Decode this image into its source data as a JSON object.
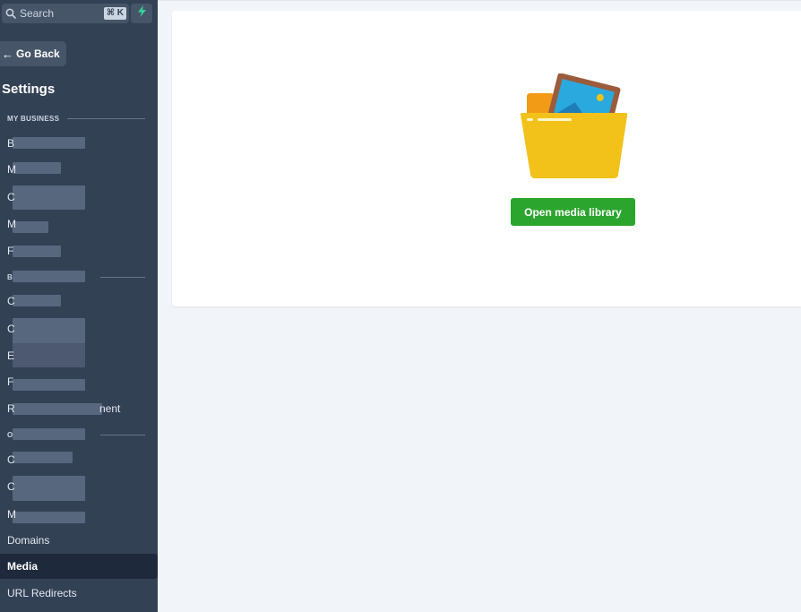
{
  "search": {
    "placeholder": "Search",
    "shortcut": "⌘ K"
  },
  "sidebar": {
    "go_back_label": "Go Back",
    "title": "Settings",
    "sections": [
      {
        "heading": "MY BUSINESS"
      },
      {
        "heading": "B"
      },
      {
        "heading": "O"
      }
    ],
    "items": [
      {
        "label": "B"
      },
      {
        "label": "M"
      },
      {
        "label": "C"
      },
      {
        "label": "M"
      },
      {
        "label": "F"
      },
      {
        "label": "C"
      },
      {
        "label": "C"
      },
      {
        "label": "E"
      },
      {
        "label": "F"
      },
      {
        "label": "R",
        "suffix": "nent"
      },
      {
        "label": "C"
      },
      {
        "label": "C"
      },
      {
        "label": "M"
      },
      {
        "label": "Domains"
      },
      {
        "label": "Media"
      },
      {
        "label": "URL Redirects"
      }
    ]
  },
  "main": {
    "open_button_label": "Open media library"
  },
  "colors": {
    "sidebar_bg": "#334155",
    "active_item_bg": "#1e293b",
    "primary_button": "#2ca52f",
    "folder": "#f2c21b",
    "bolt": "#34d399"
  }
}
